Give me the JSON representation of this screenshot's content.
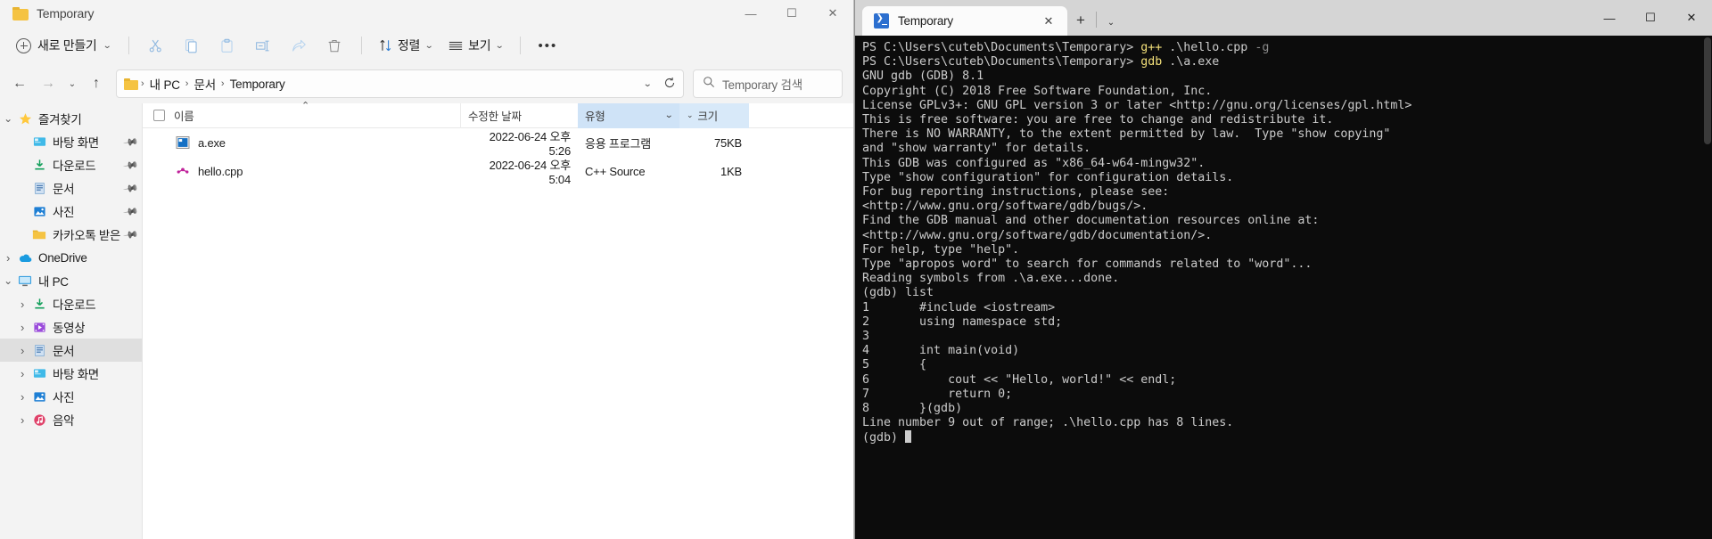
{
  "explorer": {
    "window_title": "Temporary",
    "title_icon": "folder-icon",
    "window_controls": {
      "minimize": "—",
      "maximize": "☐",
      "close": "✕"
    },
    "toolbar": {
      "new_label": "새로 만들기",
      "new_chevron": "⌄",
      "cut_icon": "scissors-icon",
      "copy_icon": "copy-icon",
      "paste_icon": "paste-icon",
      "rename_icon": "rename-icon",
      "share_icon": "share-icon",
      "delete_icon": "trash-icon",
      "sort_label": "정렬",
      "sort_icon": "sort-arrows-icon",
      "view_label": "보기",
      "view_icon": "view-lines-icon",
      "more_label": "•••"
    },
    "navigation": {
      "back": "←",
      "forward": "→",
      "recent_chevron": "⌄",
      "up": "↑",
      "breadcrumbs": [
        "내 PC",
        "문서",
        "Temporary"
      ],
      "separator": "›",
      "dropdown_chevron": "⌄",
      "refresh_icon": "refresh-icon",
      "search_placeholder": "Temporary 검색",
      "search_icon": "search-icon"
    },
    "sidebar": {
      "items": [
        {
          "label": "즐겨찾기",
          "icon": "star-icon",
          "indent": 0,
          "twisty": "⌄",
          "pinned": false,
          "selected": false
        },
        {
          "label": "바탕 화면",
          "icon": "desktop-icon",
          "indent": 1,
          "twisty": "",
          "pinned": true,
          "selected": false
        },
        {
          "label": "다운로드",
          "icon": "download-icon",
          "indent": 1,
          "twisty": "",
          "pinned": true,
          "selected": false
        },
        {
          "label": "문서",
          "icon": "document-icon",
          "indent": 1,
          "twisty": "",
          "pinned": true,
          "selected": false
        },
        {
          "label": "사진",
          "icon": "pictures-icon",
          "indent": 1,
          "twisty": "",
          "pinned": true,
          "selected": false
        },
        {
          "label": "카카오톡 받은",
          "icon": "folder-icon",
          "indent": 1,
          "twisty": "",
          "pinned": true,
          "selected": false
        },
        {
          "label": "OneDrive",
          "icon": "onedrive-cloud-icon",
          "indent": 0,
          "twisty": "›",
          "pinned": false,
          "selected": false
        },
        {
          "label": "내 PC",
          "icon": "this-pc-icon",
          "indent": 0,
          "twisty": "⌄",
          "pinned": false,
          "selected": false
        },
        {
          "label": "다운로드",
          "icon": "download-icon",
          "indent": 1,
          "twisty": "›",
          "pinned": false,
          "selected": false
        },
        {
          "label": "동영상",
          "icon": "videos-icon",
          "indent": 1,
          "twisty": "›",
          "pinned": false,
          "selected": false
        },
        {
          "label": "문서",
          "icon": "document-icon",
          "indent": 1,
          "twisty": "›",
          "pinned": false,
          "selected": true
        },
        {
          "label": "바탕 화면",
          "icon": "desktop-icon",
          "indent": 1,
          "twisty": "›",
          "pinned": false,
          "selected": false
        },
        {
          "label": "사진",
          "icon": "pictures-icon",
          "indent": 1,
          "twisty": "›",
          "pinned": false,
          "selected": false
        },
        {
          "label": "음악",
          "icon": "music-icon",
          "indent": 1,
          "twisty": "›",
          "pinned": false,
          "selected": false
        }
      ]
    },
    "file_list": {
      "columns": {
        "name": "이름",
        "date_modified": "수정한 날짜",
        "type": "유형",
        "size": "크기"
      },
      "sort_indicator": "⌃",
      "rows": [
        {
          "name": "a.exe",
          "date": "2022-06-24 오후 5:26",
          "type": "응용 프로그램",
          "size": "75KB",
          "icon": "exe-application-icon"
        },
        {
          "name": "hello.cpp",
          "date": "2022-06-24 오후 5:04",
          "type": "C++ Source",
          "size": "1KB",
          "icon": "cpp-source-icon"
        }
      ]
    }
  },
  "terminal": {
    "tab_title": "Temporary",
    "tab_icon": "powershell-icon",
    "tab_close": "✕",
    "new_tab": "+",
    "tab_dropdown": "⌄",
    "window_controls": {
      "minimize": "—",
      "maximize": "☐",
      "close": "✕"
    },
    "lines": [
      {
        "segments": [
          {
            "t": "PS C:\\Users\\cuteb\\Documents\\Temporary> ",
            "c": "plain"
          },
          {
            "t": "g++",
            "c": "cmd"
          },
          {
            "t": " .\\hello.cpp ",
            "c": "plain"
          },
          {
            "t": "-g",
            "c": "flag"
          }
        ]
      },
      {
        "segments": [
          {
            "t": "PS C:\\Users\\cuteb\\Documents\\Temporary> ",
            "c": "plain"
          },
          {
            "t": "gdb",
            "c": "cmd"
          },
          {
            "t": " .\\a.exe",
            "c": "plain"
          }
        ]
      },
      {
        "segments": [
          {
            "t": "GNU gdb (GDB) 8.1",
            "c": "plain"
          }
        ]
      },
      {
        "segments": [
          {
            "t": "Copyright (C) 2018 Free Software Foundation, Inc.",
            "c": "plain"
          }
        ]
      },
      {
        "segments": [
          {
            "t": "License GPLv3+: GNU GPL version 3 or later <http://gnu.org/licenses/gpl.html>",
            "c": "plain"
          }
        ]
      },
      {
        "segments": [
          {
            "t": "This is free software: you are free to change and redistribute it.",
            "c": "plain"
          }
        ]
      },
      {
        "segments": [
          {
            "t": "There is NO WARRANTY, to the extent permitted by law.  Type \"show copying\"",
            "c": "plain"
          }
        ]
      },
      {
        "segments": [
          {
            "t": "and \"show warranty\" for details.",
            "c": "plain"
          }
        ]
      },
      {
        "segments": [
          {
            "t": "This GDB was configured as \"x86_64-w64-mingw32\".",
            "c": "plain"
          }
        ]
      },
      {
        "segments": [
          {
            "t": "Type \"show configuration\" for configuration details.",
            "c": "plain"
          }
        ]
      },
      {
        "segments": [
          {
            "t": "For bug reporting instructions, please see:",
            "c": "plain"
          }
        ]
      },
      {
        "segments": [
          {
            "t": "<http://www.gnu.org/software/gdb/bugs/>.",
            "c": "plain"
          }
        ]
      },
      {
        "segments": [
          {
            "t": "Find the GDB manual and other documentation resources online at:",
            "c": "plain"
          }
        ]
      },
      {
        "segments": [
          {
            "t": "<http://www.gnu.org/software/gdb/documentation/>.",
            "c": "plain"
          }
        ]
      },
      {
        "segments": [
          {
            "t": "For help, type \"help\".",
            "c": "plain"
          }
        ]
      },
      {
        "segments": [
          {
            "t": "Type \"apropos word\" to search for commands related to \"word\"...",
            "c": "plain"
          }
        ]
      },
      {
        "segments": [
          {
            "t": "Reading symbols from .\\a.exe...done.",
            "c": "plain"
          }
        ]
      },
      {
        "segments": [
          {
            "t": "(gdb) list",
            "c": "plain"
          }
        ]
      },
      {
        "segments": [
          {
            "t": "1       #include <iostream>",
            "c": "plain"
          }
        ]
      },
      {
        "segments": [
          {
            "t": "2       using namespace std;",
            "c": "plain"
          }
        ]
      },
      {
        "segments": [
          {
            "t": "3",
            "c": "plain"
          }
        ]
      },
      {
        "segments": [
          {
            "t": "4       int main(void)",
            "c": "plain"
          }
        ]
      },
      {
        "segments": [
          {
            "t": "5       {",
            "c": "plain"
          }
        ]
      },
      {
        "segments": [
          {
            "t": "6           cout << \"Hello, world!\" << endl;",
            "c": "plain"
          }
        ]
      },
      {
        "segments": [
          {
            "t": "7           return 0;",
            "c": "plain"
          }
        ]
      },
      {
        "segments": [
          {
            "t": "8       }(gdb)",
            "c": "plain"
          }
        ]
      },
      {
        "segments": [
          {
            "t": "Line number 9 out of range; .\\hello.cpp has 8 lines.",
            "c": "plain"
          }
        ]
      },
      {
        "segments": [
          {
            "t": "(gdb) ",
            "c": "plain"
          }
        ],
        "cursor": true
      }
    ]
  },
  "colors": {
    "explorer_chrome": "#f3f3f3",
    "terminal_bg": "#0c0c0c",
    "terminal_fg": "#cccccc",
    "command_yellow": "#f3e07a",
    "tabbar_bg": "#d5d5d5",
    "selected_column": "#cfe3f7",
    "folder_yellow": "#f5c342"
  }
}
